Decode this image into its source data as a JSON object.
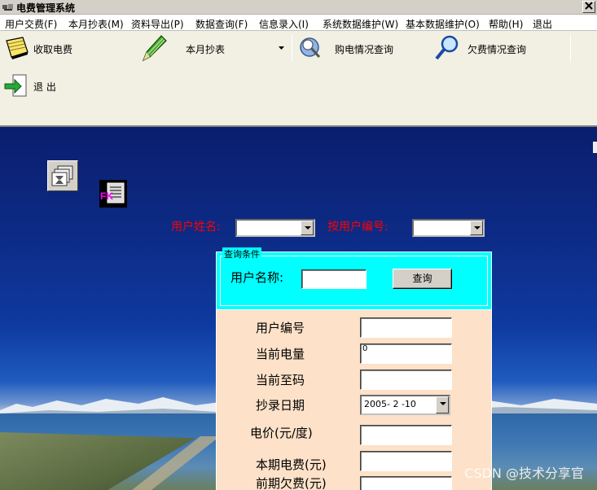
{
  "window": {
    "title": "电费管理系统"
  },
  "menu": [
    "用户交费(F)",
    "本月抄表(M)",
    "资料导出(P)",
    "数据查询(F)",
    "信息录入(I)",
    "系统数据维护(W)",
    "基本数据维护(O)",
    "帮助(H)",
    "退出"
  ],
  "toolbar": {
    "collect": "收取电费",
    "reading": "本月抄表",
    "purchase": "购电情况查询",
    "arrears": "欠费情况查询",
    "exit": "退 出"
  },
  "search": {
    "name_label": "用户姓名:",
    "id_label": "按用户编号:",
    "name_value": "",
    "id_value": ""
  },
  "query": {
    "legend": "查询条件",
    "username_label": "用户名称:",
    "username_value": "",
    "button": "查询",
    "fields": {
      "user_id": {
        "label": "用户编号",
        "value": ""
      },
      "current_power": {
        "label": "当前电量",
        "value": "0"
      },
      "current_reading": {
        "label": "当前至码",
        "value": ""
      },
      "read_date": {
        "label": "抄录日期",
        "value": "2005- 2 -10"
      },
      "price": {
        "label": "电价(元/度)",
        "value": ""
      },
      "current_fee": {
        "label": "本期电费(元)",
        "value": ""
      },
      "prev_arrears": {
        "label": "前期欠费(元)",
        "value": ""
      }
    }
  },
  "watermark": "CSDN @技术分享官"
}
